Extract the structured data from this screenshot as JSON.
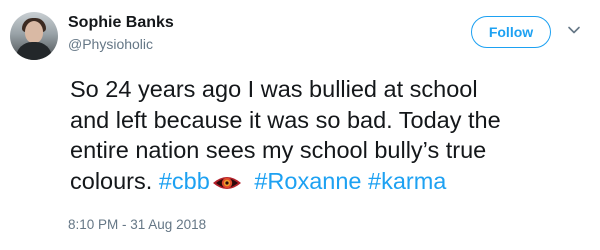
{
  "user": {
    "name": "Sophie Banks",
    "handle": "@Physioholic"
  },
  "follow_button": {
    "label": "Follow"
  },
  "tweet": {
    "line1": "So 24 years ago I was bullied at school",
    "line2": "and left because it was so bad. Today the",
    "line3": "entire nation sees my school bully’s true",
    "line4_text": "colours.",
    "hashtags": [
      "#cbb",
      "#Roxanne",
      "#karma"
    ]
  },
  "timestamp": "8:10 PM - 31 Aug 2018",
  "colors": {
    "accent": "#1da1f2",
    "text": "#14171a",
    "muted": "#657786",
    "emoji_eye": "#b3202a"
  },
  "icons": {
    "menu": "chevron-down-icon",
    "hashflag": "big-brother-eye-icon"
  }
}
